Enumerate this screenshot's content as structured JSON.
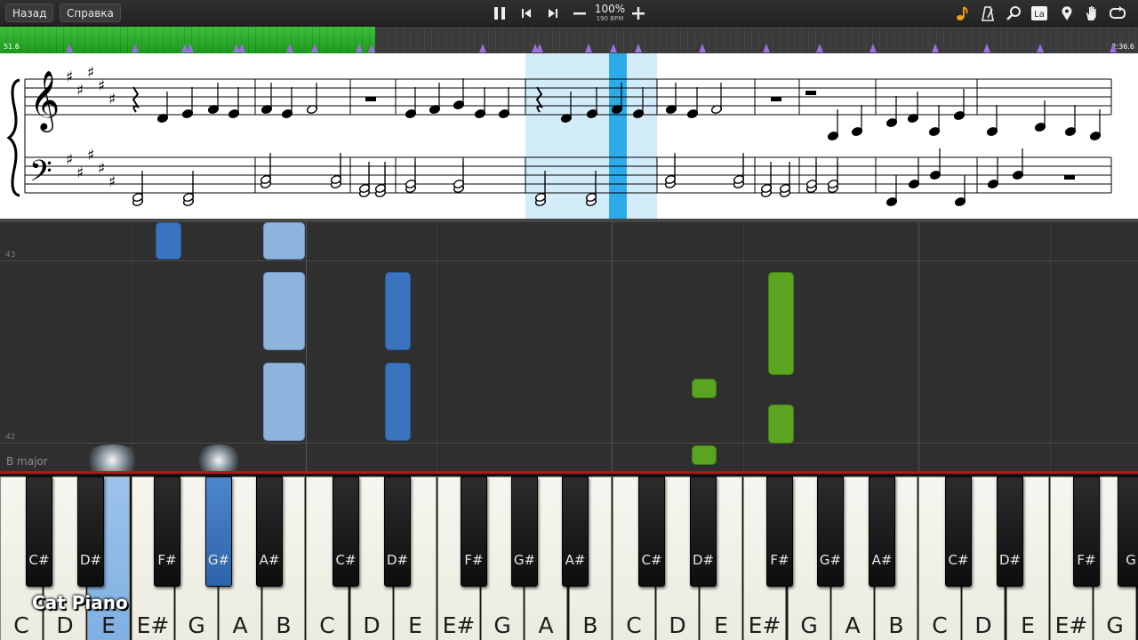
{
  "toolbar": {
    "back_label": "Назад",
    "help_label": "Справка",
    "speed_percent": "100%",
    "tempo": "190 BPM"
  },
  "timeline": {
    "elapsed": "51.6",
    "total": "2:36.6"
  },
  "note_roll": {
    "measure_top": "43",
    "measure_bottom": "42",
    "key_signature": "B major"
  },
  "keyboard": {
    "white_keys": [
      "C",
      "D",
      "E",
      "E#",
      "G",
      "A",
      "B",
      "C",
      "D",
      "E",
      "E#",
      "G",
      "A",
      "B",
      "C",
      "D",
      "E",
      "E#",
      "G",
      "A",
      "B",
      "C",
      "D",
      "E",
      "E#",
      "G"
    ],
    "black_keys": [
      "C#",
      "D#",
      "F#",
      "G#",
      "A#",
      "C#",
      "D#",
      "F#",
      "G#",
      "A#",
      "C#",
      "D#",
      "F#",
      "G#",
      "A#",
      "C#",
      "D#",
      "F#",
      "G"
    ],
    "active_white_index": 2,
    "active_black_index": 3
  },
  "overlay": {
    "logo_text": "Cat Piano"
  },
  "colors": {
    "progress_green": "#2db02b",
    "section_marker_purple": "#9a6fe0",
    "note_light_blue": "#8eb3dc",
    "note_dark_blue": "#3a74bf",
    "note_green": "#5aa41f",
    "playhead_blue": "#2eaae8",
    "keyboard_red_line": "#b11818"
  },
  "icons": [
    "play-pause-icon",
    "previous-icon",
    "next-icon",
    "minus-icon",
    "plus-icon",
    "note-icon",
    "metronome-icon",
    "search-icon",
    "note-name-icon",
    "location-pin-icon",
    "hand-icon",
    "loop-icon",
    "fullscreen-icon"
  ]
}
